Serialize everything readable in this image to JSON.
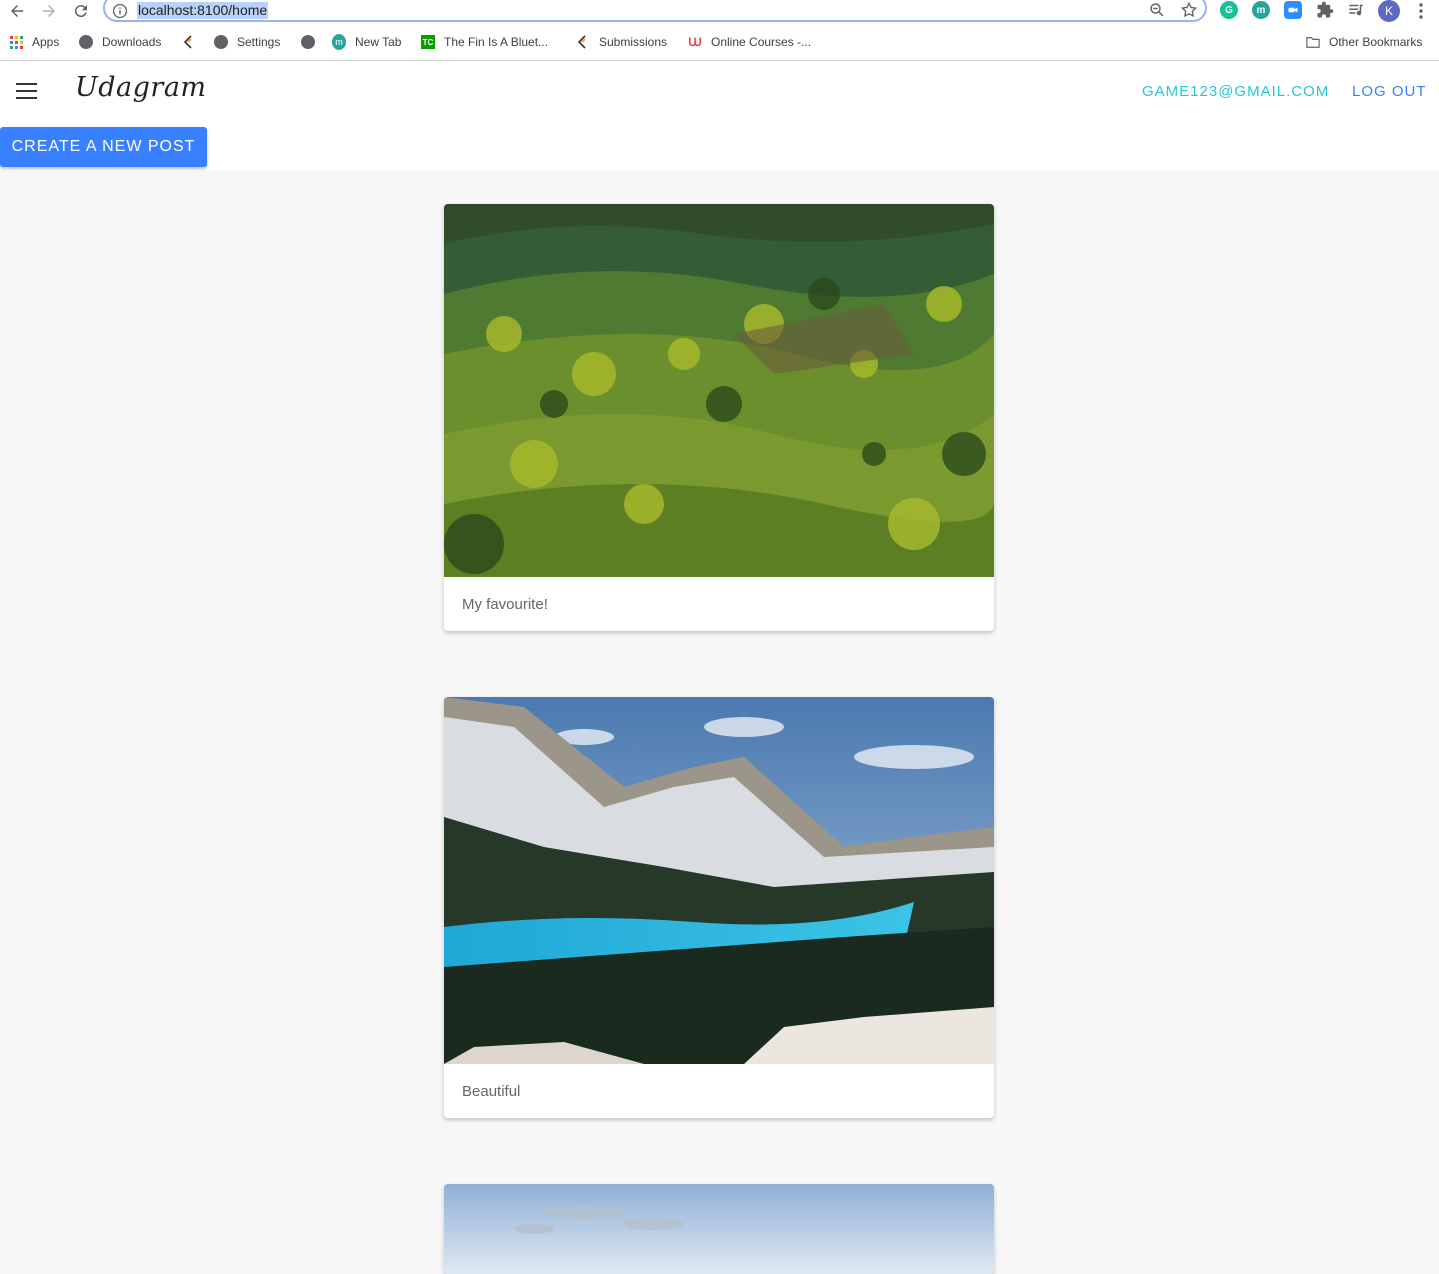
{
  "browser": {
    "url": "localhost:8100/home",
    "profile_initial": "K",
    "bookmarks": [
      {
        "label": "Apps",
        "icon": "apps-grid-icon"
      },
      {
        "label": "Downloads",
        "icon": "globe-icon"
      },
      {
        "label": "",
        "icon": "codepen-icon"
      },
      {
        "label": "Settings",
        "icon": "globe-icon"
      },
      {
        "label": "",
        "icon": "globe-icon"
      },
      {
        "label": "New Tab",
        "icon": "m-icon"
      },
      {
        "label": "The Fin Is A Bluet...",
        "icon": "tc-icon"
      },
      {
        "label": "Submissions",
        "icon": "codepen-icon"
      },
      {
        "label": "Online Courses -...",
        "icon": "udacity-icon"
      }
    ],
    "other_bookmarks": "Other Bookmarks"
  },
  "app": {
    "brand": "Udagram",
    "user_email": "GAME123@GMAIL.COM",
    "logout_label": "LOG OUT",
    "create_label": "CREATE A NEW POST"
  },
  "feed": [
    {
      "caption": "My favourite!",
      "scene": "rolling green hills landscape"
    },
    {
      "caption": "Beautiful",
      "scene": "snowy mountains above turquoise lake"
    },
    {
      "caption": "",
      "scene": "pale blue sky with clouds"
    }
  ],
  "colors": {
    "primary": "#3880ff",
    "secondary": "#26c6da",
    "background": "#f7f7f7"
  }
}
